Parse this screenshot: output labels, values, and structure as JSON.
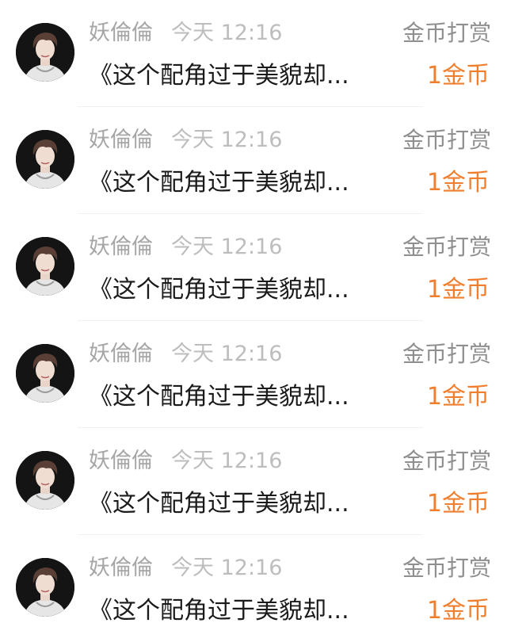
{
  "colors": {
    "username": "#a6a6a6",
    "timestamp": "#bdbdbd",
    "reward_type": "#8f8f8f",
    "message": "#1a1a1a",
    "amount_accent": "#ef7f2e",
    "divider": "#f0f0f0"
  },
  "rewards": [
    {
      "avatar_icon": "user-avatar-icon",
      "username": "妖倫倫",
      "timestamp": "今天 12:16",
      "reward_type": "金币打赏",
      "message": "《这个配角过于美貌却...",
      "amount": "1金币"
    },
    {
      "avatar_icon": "user-avatar-icon",
      "username": "妖倫倫",
      "timestamp": "今天 12:16",
      "reward_type": "金币打赏",
      "message": "《这个配角过于美貌却...",
      "amount": "1金币"
    },
    {
      "avatar_icon": "user-avatar-icon",
      "username": "妖倫倫",
      "timestamp": "今天 12:16",
      "reward_type": "金币打赏",
      "message": "《这个配角过于美貌却...",
      "amount": "1金币"
    },
    {
      "avatar_icon": "user-avatar-icon",
      "username": "妖倫倫",
      "timestamp": "今天 12:16",
      "reward_type": "金币打赏",
      "message": "《这个配角过于美貌却...",
      "amount": "1金币"
    },
    {
      "avatar_icon": "user-avatar-icon",
      "username": "妖倫倫",
      "timestamp": "今天 12:16",
      "reward_type": "金币打赏",
      "message": "《这个配角过于美貌却...",
      "amount": "1金币"
    },
    {
      "avatar_icon": "user-avatar-icon",
      "username": "妖倫倫",
      "timestamp": "今天 12:16",
      "reward_type": "金币打赏",
      "message": "《这个配角过于美貌却...",
      "amount": "1金币"
    }
  ]
}
